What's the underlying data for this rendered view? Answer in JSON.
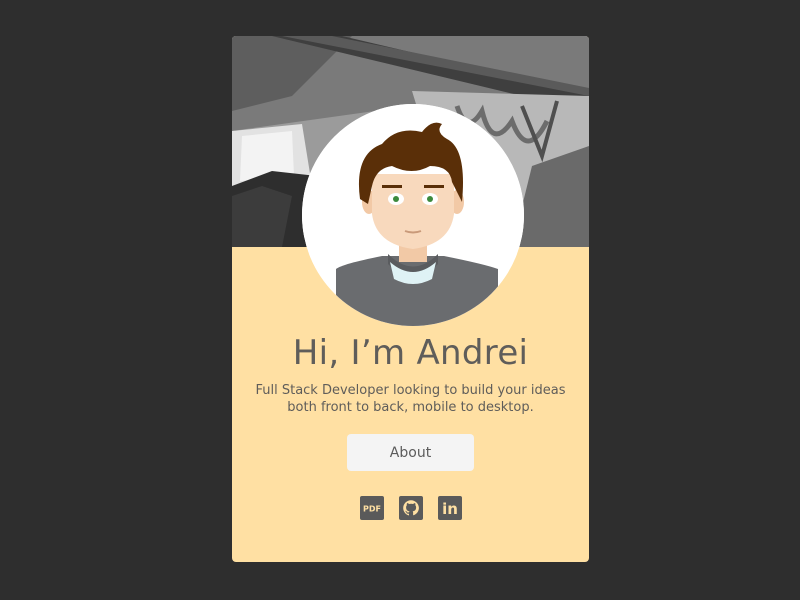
{
  "profile": {
    "heading": "Hi, I’m Andrei",
    "tagline_line1": "Full Stack Developer looking to build your ideas",
    "tagline_line2": "both front to back, mobile to desktop.",
    "about_label": "About"
  },
  "socials": [
    {
      "icon": "pdf-icon",
      "label": "PDF"
    },
    {
      "icon": "github-icon"
    },
    {
      "icon": "linkedin-icon",
      "label": "in"
    }
  ],
  "colors": {
    "page_background": "#2e2e2e",
    "card_background": "#ffe0a3",
    "text": "#5f5d5a",
    "button_background": "#f4f4f4",
    "icon": "#5a5a5a"
  }
}
